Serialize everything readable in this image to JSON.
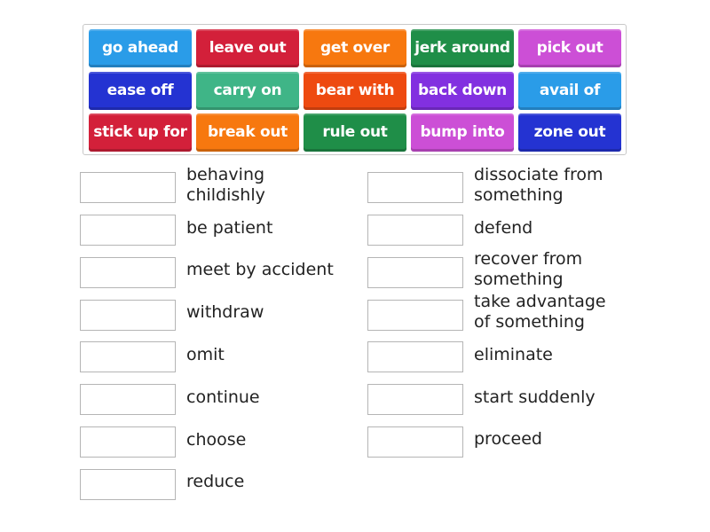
{
  "tiles": [
    {
      "label": "go ahead",
      "color": "#2a9ce8"
    },
    {
      "label": "leave out",
      "color": "#d3203a"
    },
    {
      "label": "get over",
      "color": "#f7780f"
    },
    {
      "label": "jerk around",
      "color": "#1f8e48"
    },
    {
      "label": "pick out",
      "color": "#cc4fd6"
    },
    {
      "label": "ease off",
      "color": "#2433d2"
    },
    {
      "label": "carry on",
      "color": "#3fb587"
    },
    {
      "label": "bear with",
      "color": "#ee4a10"
    },
    {
      "label": "back down",
      "color": "#8230e0"
    },
    {
      "label": "avail of",
      "color": "#2a9ce8"
    },
    {
      "label": "stick up for",
      "color": "#d3203a"
    },
    {
      "label": "break out",
      "color": "#f7780f"
    },
    {
      "label": "rule out",
      "color": "#1f8e48"
    },
    {
      "label": "bump into",
      "color": "#cc4fd6"
    },
    {
      "label": "zone out",
      "color": "#2433d2"
    }
  ],
  "left_definitions": [
    "behaving childishly",
    "be patient",
    "meet by accident",
    "withdraw",
    "omit",
    "continue",
    "choose",
    "reduce"
  ],
  "right_definitions": [
    "dissociate from something",
    "defend",
    "recover from something",
    "take advantage of something",
    "eliminate",
    "start suddenly",
    "proceed"
  ]
}
